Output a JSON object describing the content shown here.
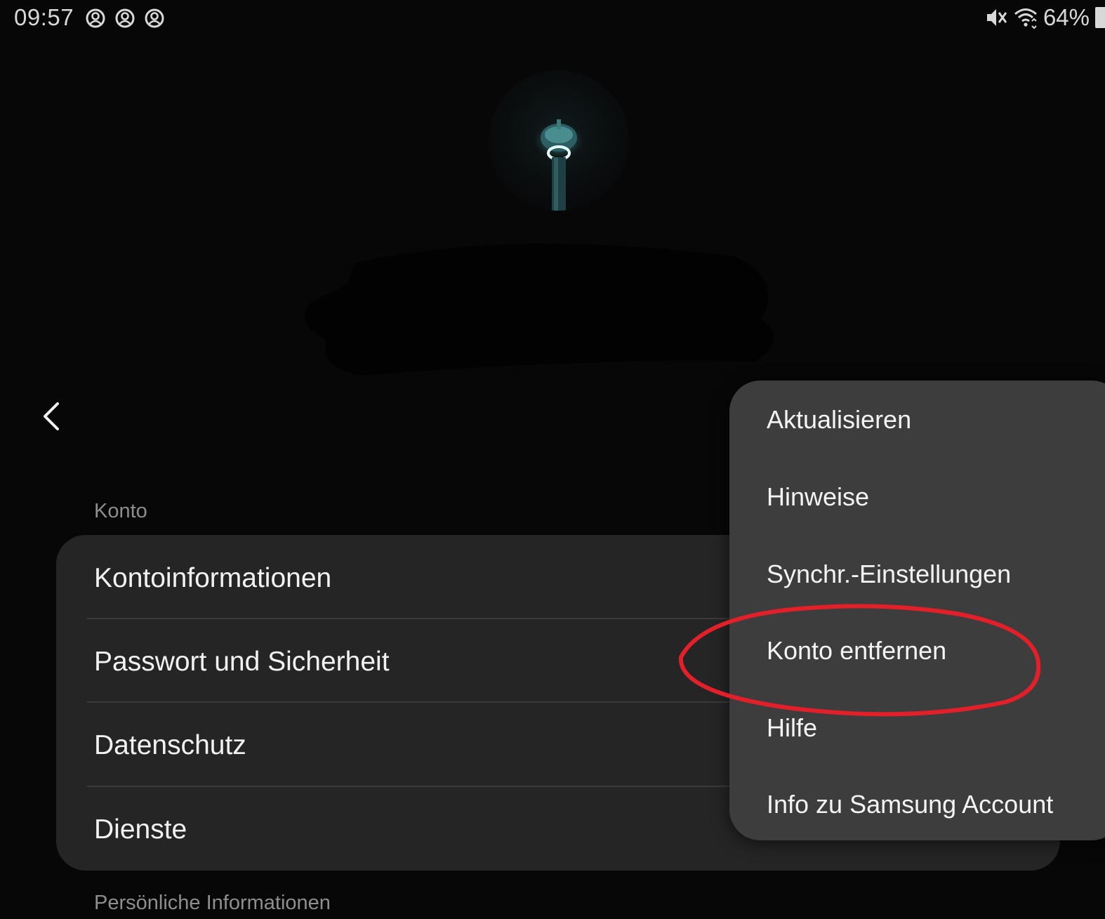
{
  "status_bar": {
    "time": "09:57",
    "battery_percent": "64%"
  },
  "profile": {
    "avatar_alt": ""
  },
  "nav": {
    "back_icon": "chevron-left-icon"
  },
  "sections": {
    "account_label": "Konto",
    "personal_label": "Persönliche Informationen"
  },
  "account_items": [
    {
      "label": "Kontoinformationen"
    },
    {
      "label": "Passwort und Sicherheit"
    },
    {
      "label": "Datenschutz"
    },
    {
      "label": "Dienste"
    }
  ],
  "menu": {
    "items": [
      {
        "label": "Aktualisieren"
      },
      {
        "label": "Hinweise"
      },
      {
        "label": "Synchr.-Einstellungen"
      },
      {
        "label": "Konto entfernen"
      },
      {
        "label": "Hilfe"
      },
      {
        "label": "Info zu Samsung Account"
      }
    ]
  },
  "colors": {
    "background": "#070707",
    "card": "#252525",
    "popup": "#3d3d3d",
    "annotation": "#e3202a",
    "section_label": "#8e8e8e"
  }
}
